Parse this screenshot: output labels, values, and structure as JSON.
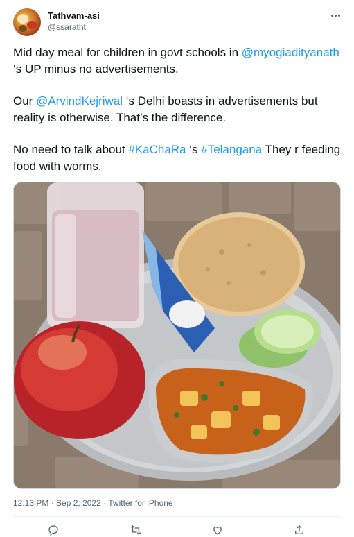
{
  "author": {
    "name": "Tathvam-asi",
    "handle": "@ssaratht"
  },
  "tweet": {
    "p1": {
      "t1": "Mid day meal for children in govt schools in ",
      "mention": "@myogiadityanath",
      "t2": " ‘s UP minus no advertisements."
    },
    "p2": {
      "t1": "Our ",
      "mention": "@ArvindKejriwal",
      "t2": " ‘s Delhi boasts in advertisements but reality is otherwise. That’s the difference."
    },
    "p3": {
      "t1": "No need to talk about ",
      "tag1": "#KaChaRa",
      "t2": " ‘s ",
      "tag2": "#Telangana",
      "t3": " They r feeding food with worms."
    }
  },
  "meta": {
    "time": "12:13 PM",
    "sep1": " · ",
    "date": "Sep 2, 2022",
    "sep2": " · ",
    "source": "Twitter for iPhone"
  },
  "actions": [
    "reply-icon",
    "retweet-icon",
    "like-icon",
    "share-icon"
  ],
  "colors": {
    "link": "#1d9bf0",
    "text": "#0f1419",
    "muted": "#536471"
  }
}
